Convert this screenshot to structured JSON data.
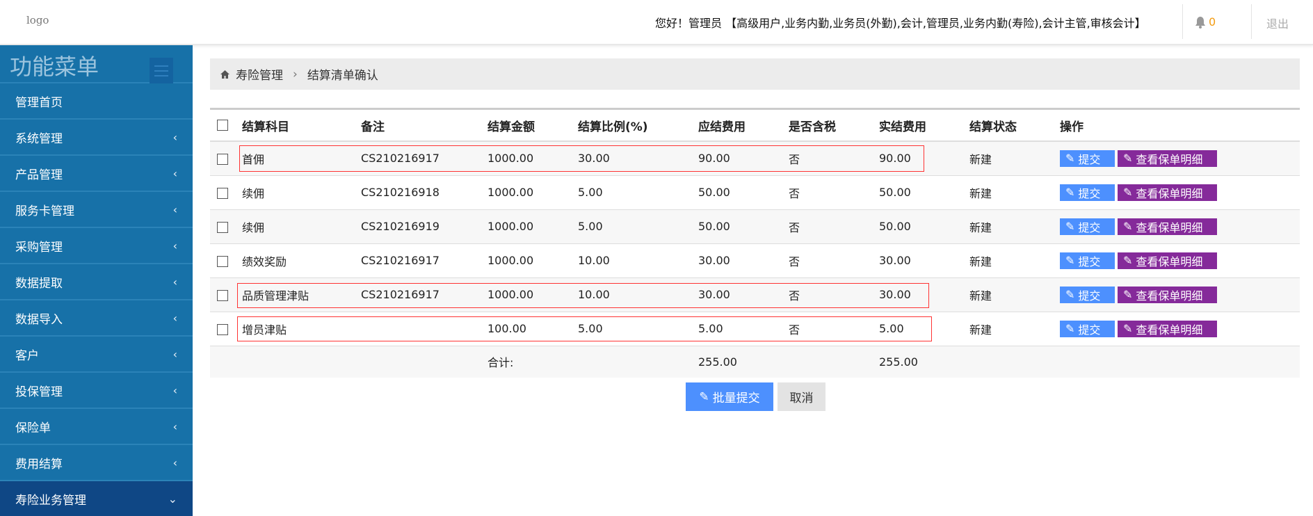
{
  "header": {
    "logo": "logo",
    "greeting": "您好！管理员 【高级用户,业务内勤,业务员(外勤),会计,管理员,业务内勤(寿险),会计主管,审核会计】",
    "notif_count": "0",
    "logout": "退出"
  },
  "sidebar": {
    "title": "功能菜单",
    "items": [
      {
        "label": "管理首页",
        "chev": ""
      },
      {
        "label": "系统管理",
        "chev": "‹"
      },
      {
        "label": "产品管理",
        "chev": "‹"
      },
      {
        "label": "服务卡管理",
        "chev": "‹"
      },
      {
        "label": "采购管理",
        "chev": "‹"
      },
      {
        "label": "数据提取",
        "chev": "‹"
      },
      {
        "label": "数据导入",
        "chev": "‹"
      },
      {
        "label": "客户",
        "chev": "‹"
      },
      {
        "label": "投保管理",
        "chev": "‹"
      },
      {
        "label": "保险单",
        "chev": "‹"
      },
      {
        "label": "费用结算",
        "chev": "‹"
      },
      {
        "label": "寿险业务管理",
        "chev": "⌄"
      }
    ]
  },
  "breadcrumb": {
    "items": [
      "寿险管理",
      "结算清单确认"
    ],
    "sep": "›"
  },
  "table": {
    "headers": [
      "结算科目",
      "备注",
      "结算金额",
      "结算比例(%)",
      "应结费用",
      "是否含税",
      "实结费用",
      "结算状态",
      "操作"
    ],
    "rows": [
      [
        "首佣",
        "CS210216917",
        "1000.00",
        "30.00",
        "90.00",
        "否",
        "90.00",
        "新建"
      ],
      [
        "续佣",
        "CS210216918",
        "1000.00",
        "5.00",
        "50.00",
        "否",
        "50.00",
        "新建"
      ],
      [
        "续佣",
        "CS210216919",
        "1000.00",
        "5.00",
        "50.00",
        "否",
        "50.00",
        "新建"
      ],
      [
        "绩效奖励",
        "CS210216917",
        "1000.00",
        "10.00",
        "30.00",
        "否",
        "30.00",
        "新建"
      ],
      [
        "品质管理津贴",
        "CS210216917",
        "1000.00",
        "10.00",
        "30.00",
        "否",
        "30.00",
        "新建"
      ],
      [
        "增员津贴",
        "",
        "100.00",
        "5.00",
        "5.00",
        "否",
        "5.00",
        "新建"
      ]
    ],
    "submit_label": "提交",
    "view_label": "查看保单明细",
    "total": {
      "label": "合计:",
      "due": "255.00",
      "actual": "255.00"
    }
  },
  "actions": {
    "batch_submit": "批量提交",
    "cancel": "取消"
  }
}
